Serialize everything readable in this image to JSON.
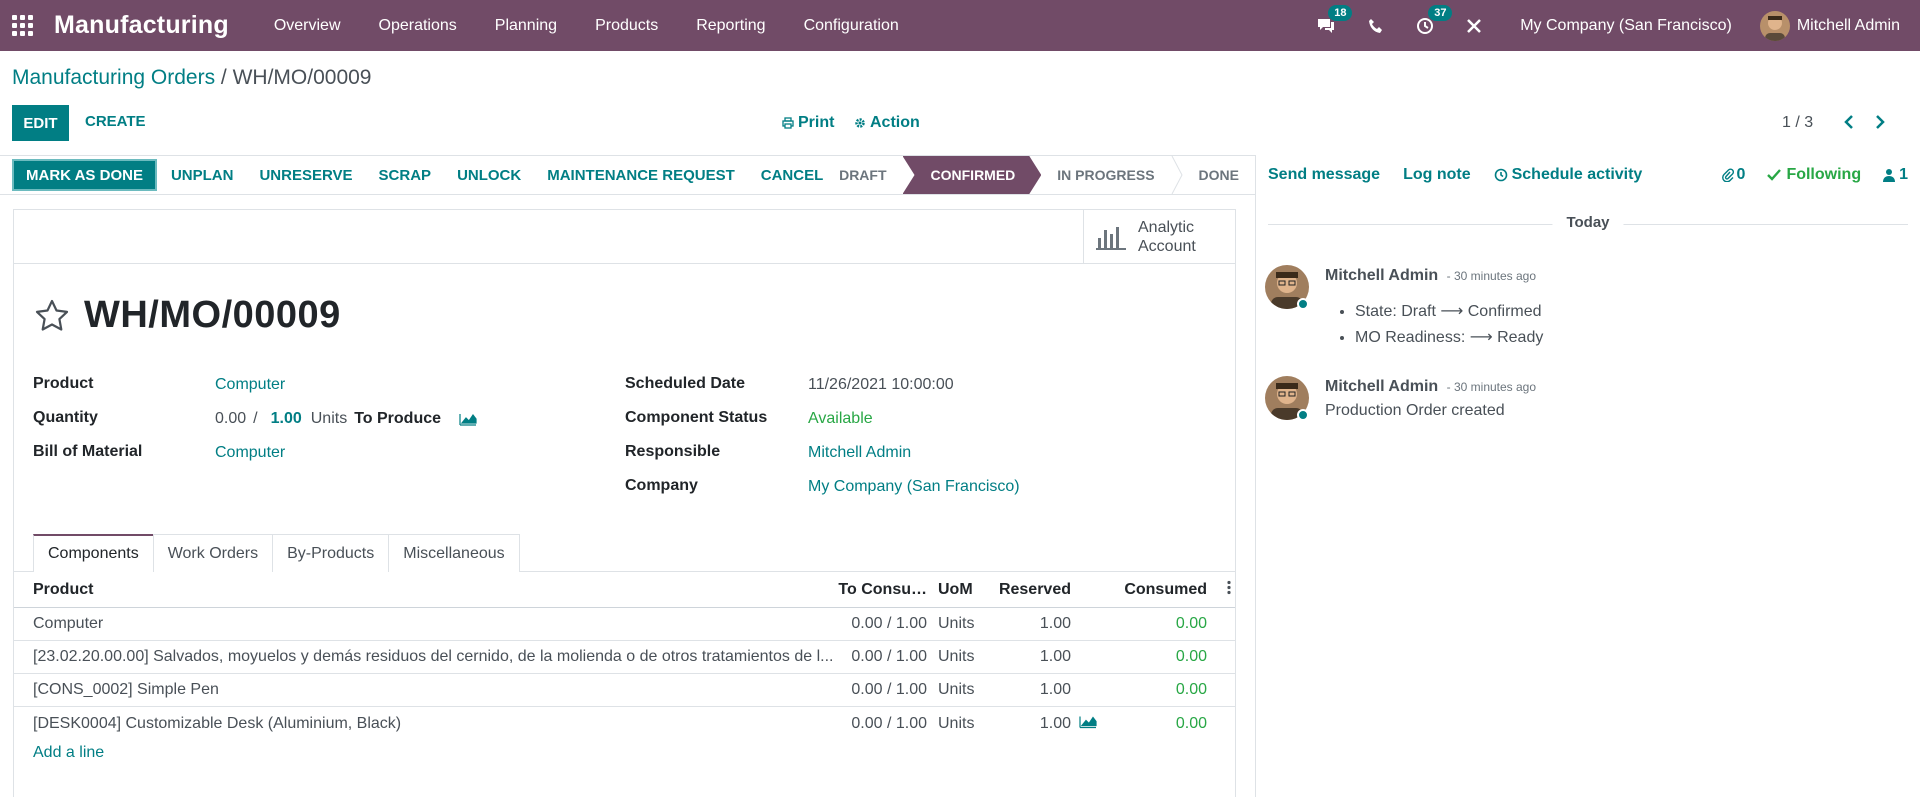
{
  "topbar": {
    "brand": "Manufacturing",
    "menu": [
      "Overview",
      "Operations",
      "Planning",
      "Products",
      "Reporting",
      "Configuration"
    ],
    "messages_badge": "18",
    "activities_badge": "37",
    "company": "My Company (San Francisco)",
    "user": "Mitchell Admin"
  },
  "breadcrumb": {
    "parent": "Manufacturing Orders",
    "separator": " / ",
    "current": "WH/MO/00009"
  },
  "controls": {
    "edit": "EDIT",
    "create": "CREATE",
    "print": "Print",
    "action": "Action",
    "pager": "1 / 3"
  },
  "statusbar": {
    "mark_done": "MARK AS DONE",
    "buttons": [
      "UNPLAN",
      "UNRESERVE",
      "SCRAP",
      "UNLOCK",
      "MAINTENANCE REQUEST",
      "CANCEL"
    ],
    "stages": [
      "DRAFT",
      "CONFIRMED",
      "IN PROGRESS",
      "DONE"
    ],
    "active_stage": "CONFIRMED"
  },
  "smart_button": {
    "line1": "Analytic",
    "line2": "Account"
  },
  "form": {
    "title": "WH/MO/00009",
    "product_label": "Product",
    "product": "Computer",
    "quantity_label": "Quantity",
    "qty_done": "0.00",
    "qty_sep": "/",
    "qty_total": "1.00",
    "qty_uom": "Units",
    "qty_suffix": "To Produce",
    "bom_label": "Bill of Material",
    "bom": "Computer",
    "date_label": "Scheduled Date",
    "date": "11/26/2021 10:00:00",
    "comp_status_label": "Component Status",
    "comp_status": "Available",
    "responsible_label": "Responsible",
    "responsible": "Mitchell Admin",
    "company_label": "Company",
    "company": "My Company (San Francisco)"
  },
  "tabs": [
    "Components",
    "Work Orders",
    "By-Products",
    "Miscellaneous"
  ],
  "table": {
    "headers": {
      "product": "Product",
      "to_consume": "To Consu…",
      "uom": "UoM",
      "reserved": "Reserved",
      "consumed": "Consumed"
    },
    "rows": [
      {
        "product": "Computer",
        "to_consume": "0.00 / 1.00",
        "uom": "Units",
        "reserved": "1.00",
        "consumed": "0.00"
      },
      {
        "product": "[23.02.20.00.00] Salvados, moyuelos y demás residuos del cernido, de la molienda o de otros tratamientos de l...",
        "to_consume": "0.00 / 1.00",
        "uom": "Units",
        "reserved": "1.00",
        "consumed": "0.00"
      },
      {
        "product": "[CONS_0002] Simple Pen",
        "to_consume": "0.00 / 1.00",
        "uom": "Units",
        "reserved": "1.00",
        "consumed": "0.00"
      },
      {
        "product": "[DESK0004] Customizable Desk (Aluminium, Black)",
        "to_consume": "0.00 / 1.00",
        "uom": "Units",
        "reserved": "1.00",
        "consumed": "0.00"
      }
    ],
    "add_line": "Add a line"
  },
  "chatter": {
    "send_message": "Send message",
    "log_note": "Log note",
    "schedule_activity": "Schedule activity",
    "attachments": "0",
    "following": "Following",
    "followers": "1",
    "today": "Today",
    "messages": [
      {
        "author": "Mitchell Admin",
        "when": "- 30 minutes ago",
        "items": [
          "State: Draft ⟶ Confirmed",
          "MO Readiness: ⟶ Ready"
        ]
      },
      {
        "author": "Mitchell Admin",
        "when": "- 30 minutes ago",
        "text": "Production Order created"
      }
    ]
  },
  "colors": {
    "brand": "#714B67",
    "accent": "#017E84",
    "success": "#28a745"
  }
}
